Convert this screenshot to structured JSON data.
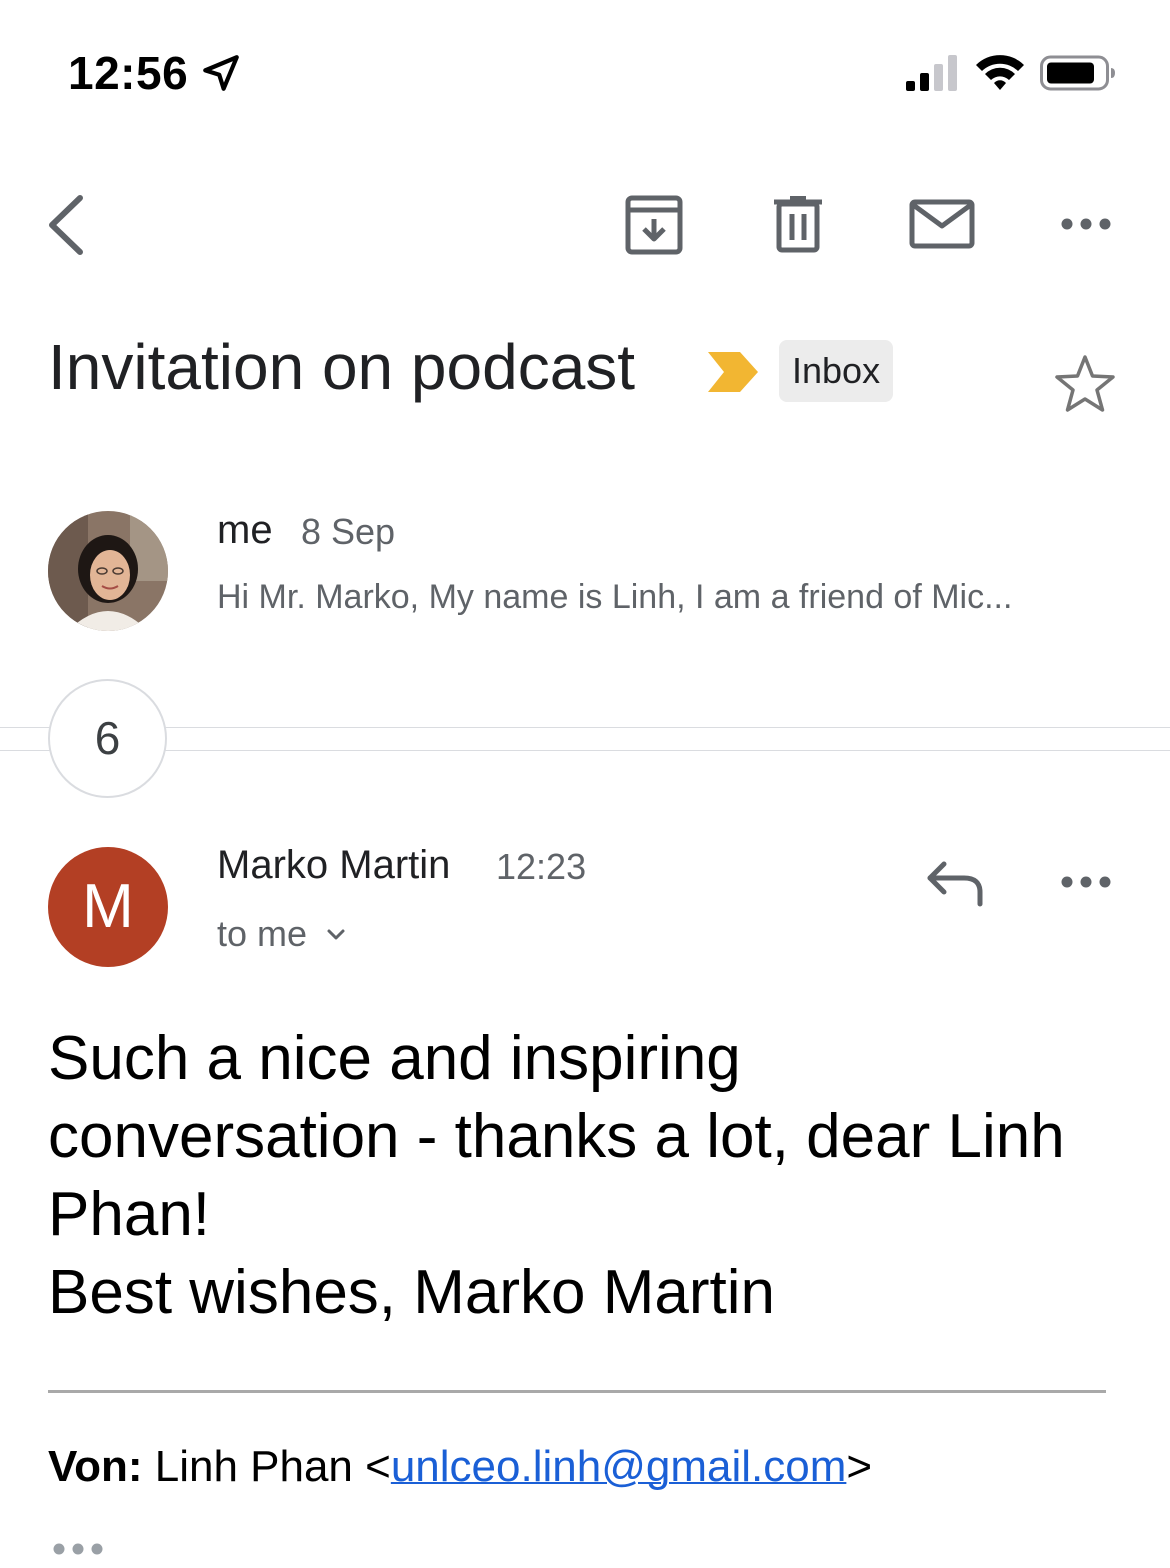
{
  "status_bar": {
    "time": "12:56"
  },
  "toolbar": {
    "back_icon": "chevron-left-icon",
    "archive_icon": "archive-icon",
    "delete_icon": "trash-icon",
    "mark_unread_icon": "mail-icon",
    "more_icon": "more-horizontal-icon"
  },
  "thread": {
    "subject": "Invitation on podcast",
    "label": "Inbox",
    "label_marker_color": "#f2b632",
    "starred": false
  },
  "collapsed_message": {
    "sender": "me",
    "date": "8 Sep",
    "snippet": "Hi Mr. Marko, My name is Linh, I am a friend of Mic..."
  },
  "collapsed_count": "6",
  "message": {
    "avatar_letter": "M",
    "avatar_color": "#b33f24",
    "sender": "Marko Martin",
    "time": "12:23",
    "recipients": "to me",
    "body_lines": [
      "Such a nice and inspiring",
      "conversation - thanks a lot, dear Linh",
      "Phan!",
      "Best wishes, Marko Martin"
    ],
    "quoted_from_label": "Von:",
    "quoted_from_name": "Linh Phan <",
    "quoted_from_email": "unlceo.linh@gmail.com",
    "quoted_from_close": ">"
  }
}
